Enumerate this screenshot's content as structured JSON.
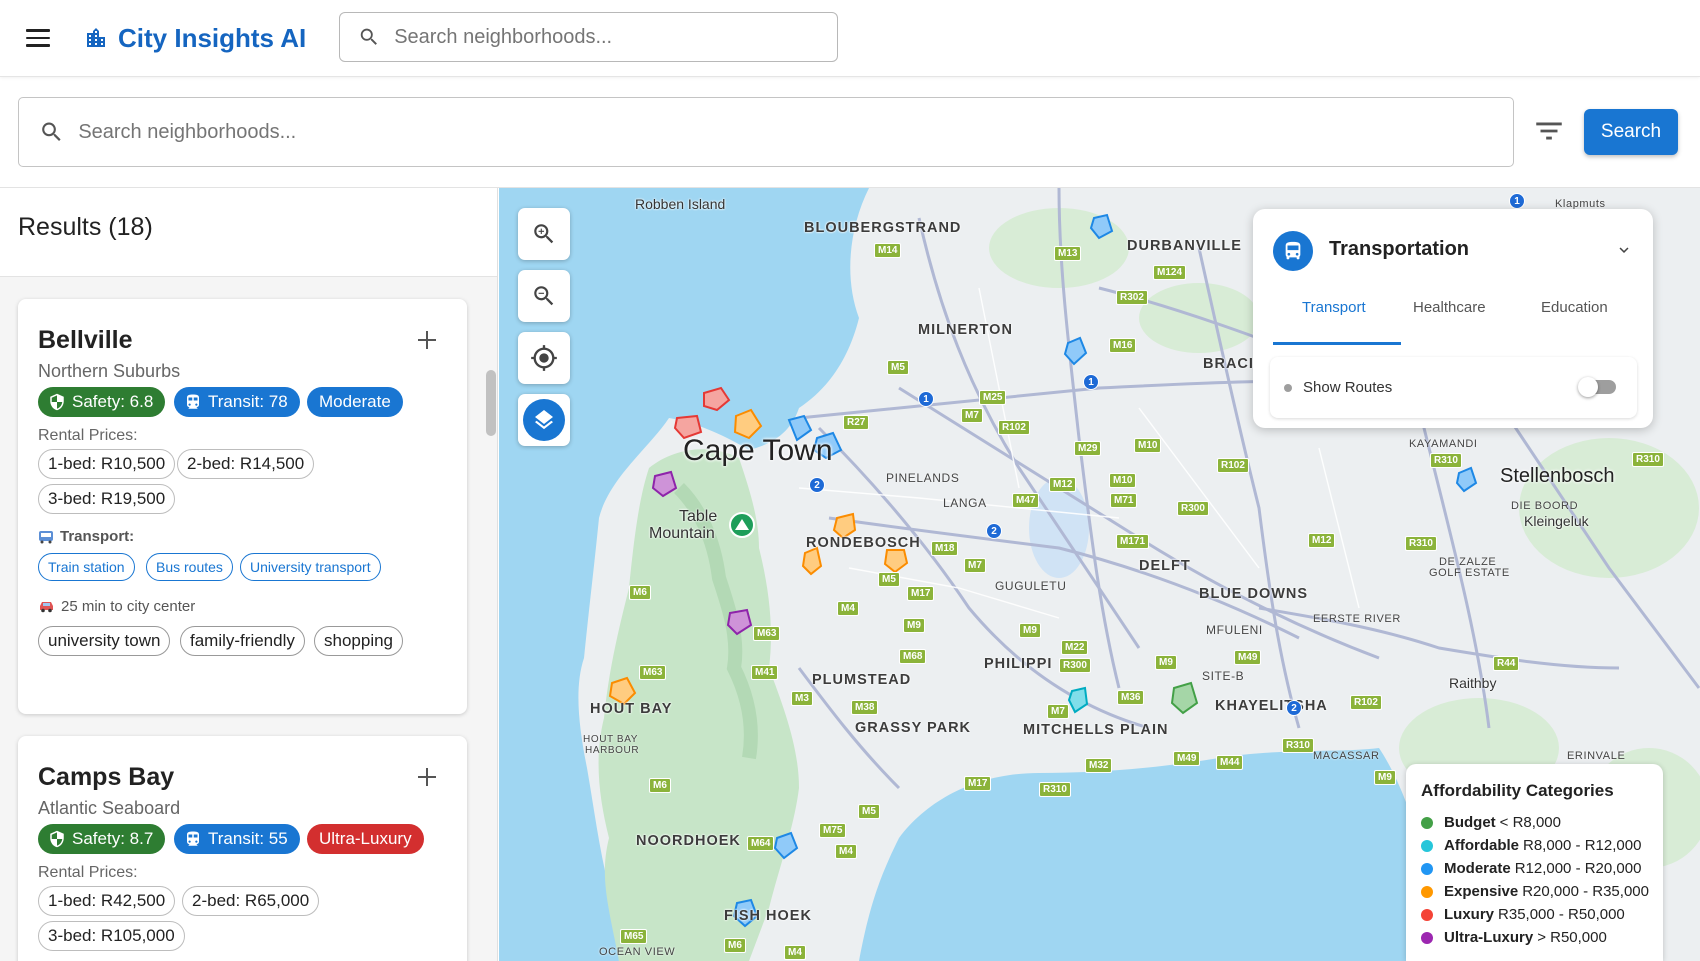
{
  "app": {
    "title": "City Insights AI",
    "logo_icon": "city-icon"
  },
  "top_search": {
    "placeholder": "Search neighborhoods..."
  },
  "main_search": {
    "placeholder": "Search neighborhoods...",
    "button": "Search"
  },
  "results": {
    "title": "Results (18)"
  },
  "cards": [
    {
      "name": "Bellville",
      "region": "Northern Suburbs",
      "safety": "Safety: 6.8",
      "transit": "Transit: 78",
      "category": "Moderate",
      "rental_label": "Rental Prices:",
      "prices": [
        "1-bed: R10,500",
        "2-bed: R14,500",
        "3-bed: R19,500"
      ],
      "transport_label": "Transport:",
      "transport": [
        "Train station",
        "Bus routes",
        "University transport"
      ],
      "commute": "25 min to city center",
      "tags": [
        "university town",
        "family-friendly",
        "shopping"
      ]
    },
    {
      "name": "Camps Bay",
      "region": "Atlantic Seaboard",
      "safety": "Safety: 8.7",
      "transit": "Transit: 55",
      "category": "Ultra-Luxury",
      "rental_label": "Rental Prices:",
      "prices": [
        "1-bed: R42,500",
        "2-bed: R65,000",
        "3-bed: R105,000"
      ]
    }
  ],
  "map": {
    "labels": {
      "robben": "Robben Island",
      "bloubergstrand": "BLOUBERGSTRAND",
      "durbanville": "DURBANVILLE",
      "milnerton": "MILNERTON",
      "braci": "BRACI",
      "cape_town": "Cape Town",
      "pinelands": "PINELANDS",
      "langa": "LANGA",
      "table_mountain_1": "Table",
      "table_mountain_2": "Mountain",
      "rondebosch": "RONDEBOSCH",
      "guguletu": "GUGULETU",
      "delft": "DELFT",
      "blue_downs": "BLUE DOWNS",
      "mfuleni": "MFULENI",
      "philippi": "PHILIPPI",
      "site_b": "SITE-B",
      "plumstead": "PLUMSTEAD",
      "grassy_park": "GRASSY PARK",
      "hout_bay": "HOUT BAY",
      "hout_bay_harbour_1": "HOUT BAY",
      "hout_bay_harbour_2": "HARBOUR",
      "mitchells_plain": "MITCHELLS PLAIN",
      "khayelitsha": "KHAYELITSHA",
      "noordhoek": "NOORDHOEK",
      "fish_hoek": "FISH HOEK",
      "ocean_view": "OCEAN VIEW",
      "kayamandi": "KAYAMANDI",
      "stellenbosch": "Stellenbosch",
      "die_boord": "DIE BOORD",
      "kleingeluk": "Kleingeluk",
      "de_zalze_1": "DE ZALZE",
      "de_zalze_2": "GOLF ESTATE",
      "eerste_river": "EERSTE RIVER",
      "raithby": "Raithby",
      "macassar": "MACASSAR",
      "erinvale": "ERINVALE",
      "klapmuts": "Klapmuts"
    }
  },
  "transport_panel": {
    "title": "Transportation",
    "tabs": [
      "Transport",
      "Healthcare",
      "Education"
    ],
    "active_tab": "Transport",
    "show_routes": "Show Routes",
    "show_routes_on": false
  },
  "legend": {
    "title": "Affordability Categories",
    "items": [
      {
        "name": "Budget",
        "range": "< R8,000",
        "color": "#43a047"
      },
      {
        "name": "Affordable",
        "range": "R8,000 - R12,000",
        "color": "#26c6da"
      },
      {
        "name": "Moderate",
        "range": "R12,000 - R20,000",
        "color": "#2196f3"
      },
      {
        "name": "Expensive",
        "range": "R20,000 - R35,000",
        "color": "#ff9800"
      },
      {
        "name": "Luxury",
        "range": "R35,000 - R50,000",
        "color": "#f44336"
      },
      {
        "name": "Ultra-Luxury",
        "range": "> R50,000",
        "color": "#9c27b0"
      }
    ]
  },
  "colors": {
    "primary": "#1976d2",
    "brand": "#1565c0",
    "safety": "#2e7d32",
    "ultra_luxury": "#d32f2f"
  }
}
